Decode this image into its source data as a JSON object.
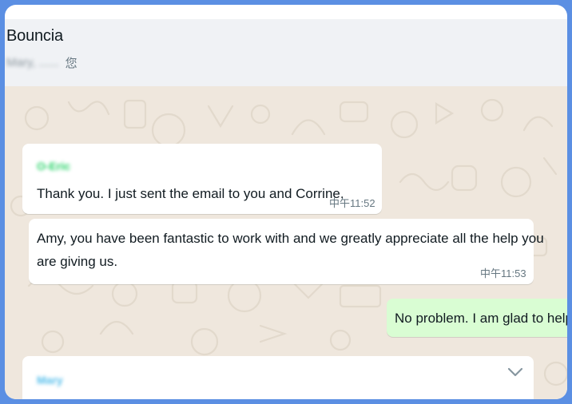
{
  "header": {
    "group_name": "Bouncia",
    "members_blurred": "Mary, ......",
    "members_suffix": "您"
  },
  "messages": [
    {
      "sender": "O-Eric",
      "text": "Thank you. I just sent the email to you and Corrine.",
      "time": "中午11:52",
      "direction": "in"
    },
    {
      "text_line1": "Amy, you have been fantastic to work with and we greatly appreciate all the help you",
      "text_line2": "are giving us.",
      "time": "中午11:53",
      "direction": "in"
    },
    {
      "text": "No problem. I am glad to help.",
      "direction": "out"
    },
    {
      "sender": "Mary",
      "direction": "in"
    }
  ],
  "colors": {
    "outer_border": "#5b8fe3",
    "chat_bg": "#efe7dd",
    "header_bg": "#f0f2f5",
    "outgoing_bubble": "#d9fdd3",
    "sender_eric": "#25d366",
    "sender_mary": "#53bdeb"
  },
  "icons": {
    "message_menu": "chevron-down-icon"
  }
}
